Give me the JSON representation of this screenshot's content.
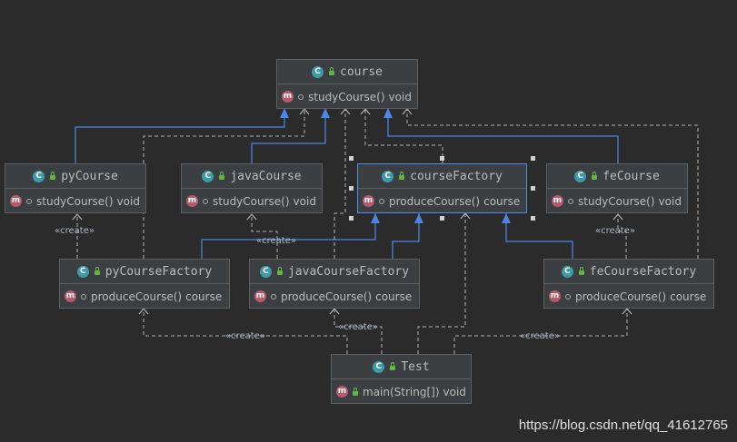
{
  "classes": {
    "course": {
      "name": "course",
      "method": "studyCourse()",
      "type": "void"
    },
    "pyCourse": {
      "name": "pyCourse",
      "method": "studyCourse()",
      "type": "void"
    },
    "javaCourse": {
      "name": "javaCourse",
      "method": "studyCourse()",
      "type": "void"
    },
    "courseFactory": {
      "name": "courseFactory",
      "method": "produceCourse()",
      "type": "course"
    },
    "feCourse": {
      "name": "feCourse",
      "method": "studyCourse()",
      "type": "void"
    },
    "pyCourseFactory": {
      "name": "pyCourseFactory",
      "method": "produceCourse()",
      "type": "course"
    },
    "javaCourseFactory": {
      "name": "javaCourseFactory",
      "method": "produceCourse()",
      "type": "course"
    },
    "feCourseFactory": {
      "name": "feCourseFactory",
      "method": "produceCourse()",
      "type": "course"
    },
    "test": {
      "name": "Test",
      "method": "main(String[])",
      "type": "void"
    }
  },
  "stereotype": "«create»",
  "watermark": "https://blog.csdn.net/qq_41612765",
  "icons": {
    "class": "C",
    "method": "m"
  },
  "colors": {
    "background": "#2b2b2b",
    "box": "#3c3f41",
    "border": "#5d5f61",
    "selection": "#4d8ee8",
    "inheritance": "#4a88e8",
    "dependency": "#b0b0b0"
  }
}
